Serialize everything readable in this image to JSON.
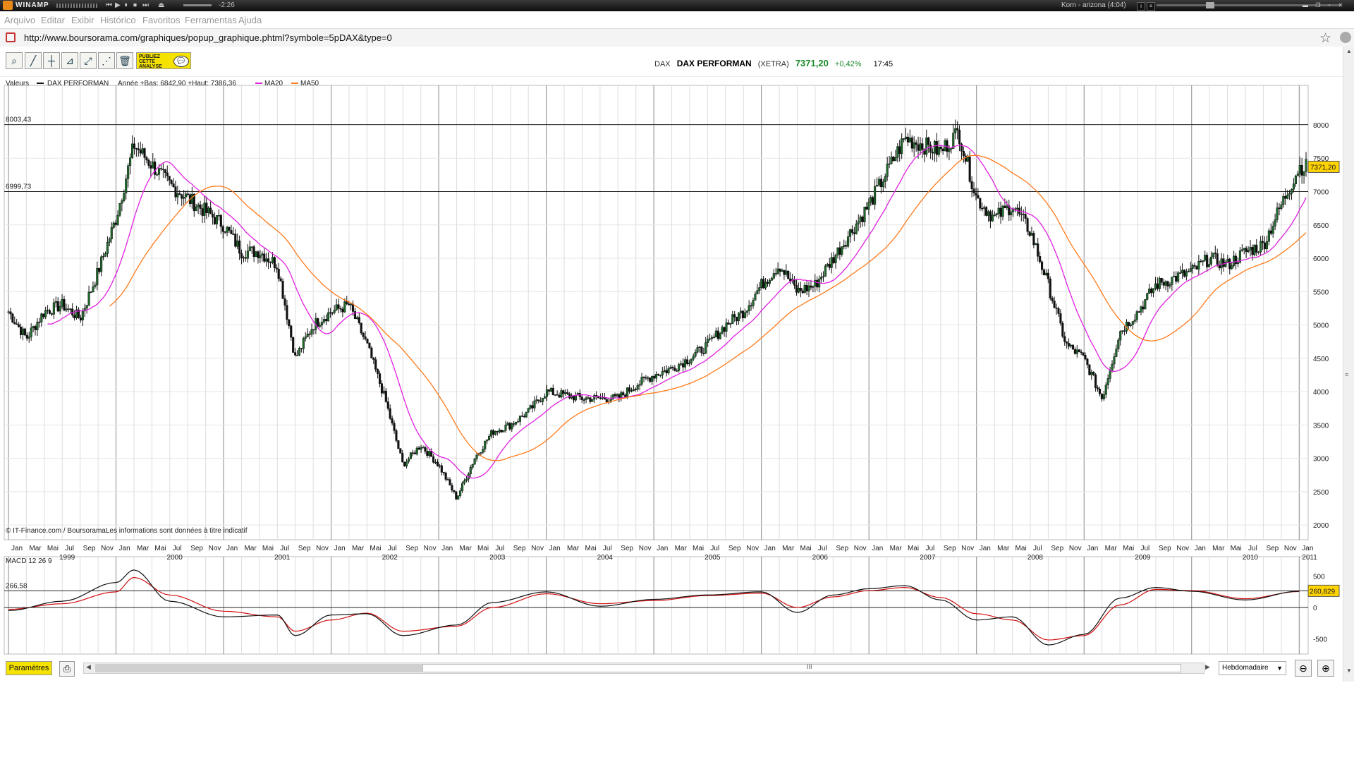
{
  "winamp": {
    "title": "WINAMP",
    "time": "-2:26",
    "track": "Korn - arizona (4:04)",
    "controls": [
      "⏮",
      "▶",
      "⏸",
      "⏹",
      "⏭",
      "⏏"
    ]
  },
  "menu": [
    "Arquivo",
    "Editar",
    "Exibir",
    "Histórico",
    "Favoritos",
    "Ferramentas",
    "Ajuda"
  ],
  "url": "http://www.boursorama.com/graphiques/popup_graphique.phtml?symbole=5pDAX&type=0",
  "toolbar": {
    "publiez_lines": [
      "PUBLIEZ",
      "CETTE",
      "ANALYSE"
    ]
  },
  "quote": {
    "code": "DAX",
    "name": "DAX PERFORMAN",
    "market": "(XETRA)",
    "price": "7371,20",
    "variation": "+0,42%",
    "time": "17:45",
    "colors": {
      "up": "#1a8a2a"
    }
  },
  "legend": {
    "valeurs": "Valeurs",
    "series_name": "DAX PERFORMAN",
    "range_text": "Année +Bas: 6842,90 +Haut: 7386,36",
    "ma20": "MA20",
    "ma50": "MA50",
    "ma20_color": "#e020e0",
    "ma50_color": "#ff7a1a"
  },
  "chart_data": [
    {
      "type": "candlestick",
      "title": "DAX PERFORMAN",
      "timeframe": "Hebdomadaire",
      "ylim": [
        1800,
        8550
      ],
      "yticks": [
        2000,
        2500,
        3000,
        3500,
        4000,
        4500,
        5000,
        5500,
        6000,
        6500,
        7000,
        7500,
        8000
      ],
      "ytick_labels": [
        "2000",
        "2500",
        "3000",
        "3500",
        "4000",
        "4500",
        "5000",
        "5500",
        "6000",
        "6500",
        "7000",
        "7500",
        "8000"
      ],
      "hlines": [
        {
          "value": 8003.43,
          "label": "8003,43"
        },
        {
          "value": 6999.73,
          "label": "6999,73"
        }
      ],
      "last_label": "7371,20",
      "x_month_labels": [
        "Jan",
        "Mar",
        "Mai",
        "Jul",
        "Sep",
        "Nov"
      ],
      "x_year_labels": [
        "1999",
        "2000",
        "2001",
        "2002",
        "2003",
        "2004",
        "2005",
        "2006",
        "2007",
        "2008",
        "2009",
        "2010",
        "2011"
      ],
      "x_end": "Jan 2011",
      "series": [
        {
          "name": "DAX PERFORMAN",
          "x": [
            "1999-01",
            "1999-03",
            "1999-05",
            "1999-07",
            "1999-09",
            "1999-11",
            "2000-01",
            "2000-03",
            "2000-05",
            "2000-07",
            "2000-09",
            "2000-11",
            "2001-01",
            "2001-03",
            "2001-05",
            "2001-07",
            "2001-09",
            "2001-11",
            "2002-01",
            "2002-03",
            "2002-05",
            "2002-07",
            "2002-09",
            "2002-11",
            "2003-01",
            "2003-03",
            "2003-05",
            "2003-07",
            "2003-09",
            "2003-11",
            "2004-01",
            "2004-03",
            "2004-05",
            "2004-07",
            "2004-09",
            "2004-11",
            "2005-01",
            "2005-03",
            "2005-05",
            "2005-07",
            "2005-09",
            "2005-11",
            "2006-01",
            "2006-03",
            "2006-05",
            "2006-07",
            "2006-09",
            "2006-11",
            "2007-01",
            "2007-03",
            "2007-05",
            "2007-07",
            "2007-09",
            "2007-11",
            "2008-01",
            "2008-03",
            "2008-05",
            "2008-07",
            "2008-09",
            "2008-11",
            "2009-01",
            "2009-03",
            "2009-05",
            "2009-07",
            "2009-09",
            "2009-11",
            "2010-01",
            "2010-03",
            "2010-05",
            "2010-07",
            "2010-09",
            "2010-11",
            "2011-01"
          ],
          "values": [
            5200,
            4800,
            5200,
            5300,
            5100,
            5800,
            6600,
            7700,
            7400,
            7100,
            6900,
            6700,
            6500,
            6100,
            6100,
            5900,
            4500,
            5000,
            5200,
            5300,
            4700,
            3900,
            2900,
            3200,
            2900,
            2400,
            3000,
            3400,
            3500,
            3700,
            4000,
            3950,
            3900,
            3900,
            3900,
            4100,
            4250,
            4350,
            4500,
            4700,
            5000,
            5200,
            5600,
            5900,
            5500,
            5600,
            6000,
            6400,
            6800,
            7300,
            7800,
            7700,
            7600,
            7900,
            6900,
            6600,
            6800,
            6400,
            5600,
            4700,
            4500,
            3900,
            4900,
            5200,
            5600,
            5700,
            5800,
            6000,
            5900,
            6100,
            6200,
            6800,
            7371
          ]
        },
        {
          "name": "MA20",
          "values_note": "20-week moving average"
        },
        {
          "name": "MA50",
          "values_note": "50-week moving average"
        }
      ]
    },
    {
      "type": "line",
      "title": "MACD 12 26 9",
      "ylim": [
        -700,
        700
      ],
      "yticks": [
        -500,
        0,
        500
      ],
      "ytick_labels": [
        "-500",
        "0",
        "500"
      ],
      "hline": {
        "value": 266.58,
        "label": "266,58"
      },
      "last_label": "260,829",
      "x": [
        "1999-01",
        "1999-07",
        "2000-01",
        "2000-03",
        "2000-07",
        "2001-01",
        "2001-07",
        "2001-09",
        "2002-01",
        "2002-05",
        "2002-09",
        "2003-03",
        "2003-07",
        "2004-01",
        "2004-07",
        "2005-01",
        "2005-07",
        "2006-01",
        "2006-05",
        "2006-09",
        "2007-01",
        "2007-05",
        "2007-09",
        "2008-01",
        "2008-05",
        "2008-09",
        "2009-01",
        "2009-05",
        "2009-09",
        "2010-01",
        "2010-07",
        "2011-01"
      ],
      "series": [
        {
          "name": "MACD",
          "values": [
            -50,
            100,
            400,
            600,
            100,
            -150,
            -120,
            -450,
            -120,
            -100,
            -450,
            -280,
            80,
            250,
            20,
            130,
            200,
            250,
            -80,
            200,
            300,
            350,
            120,
            -200,
            -150,
            -600,
            -430,
            150,
            320,
            260,
            120,
            261
          ]
        },
        {
          "name": "Signal",
          "values": [
            -30,
            60,
            250,
            480,
            200,
            -60,
            -150,
            -380,
            -200,
            -90,
            -380,
            -300,
            0,
            220,
            60,
            110,
            190,
            230,
            0,
            170,
            270,
            320,
            160,
            -100,
            -200,
            -520,
            -450,
            40,
            290,
            270,
            140,
            255
          ]
        }
      ]
    }
  ],
  "copyright": "© IT-Finance.com / BoursoramaLes informations sont données à titre indicatif",
  "bottom": {
    "params_label": "Paramètres",
    "period": "Hebdomadaire",
    "grip": "III"
  }
}
